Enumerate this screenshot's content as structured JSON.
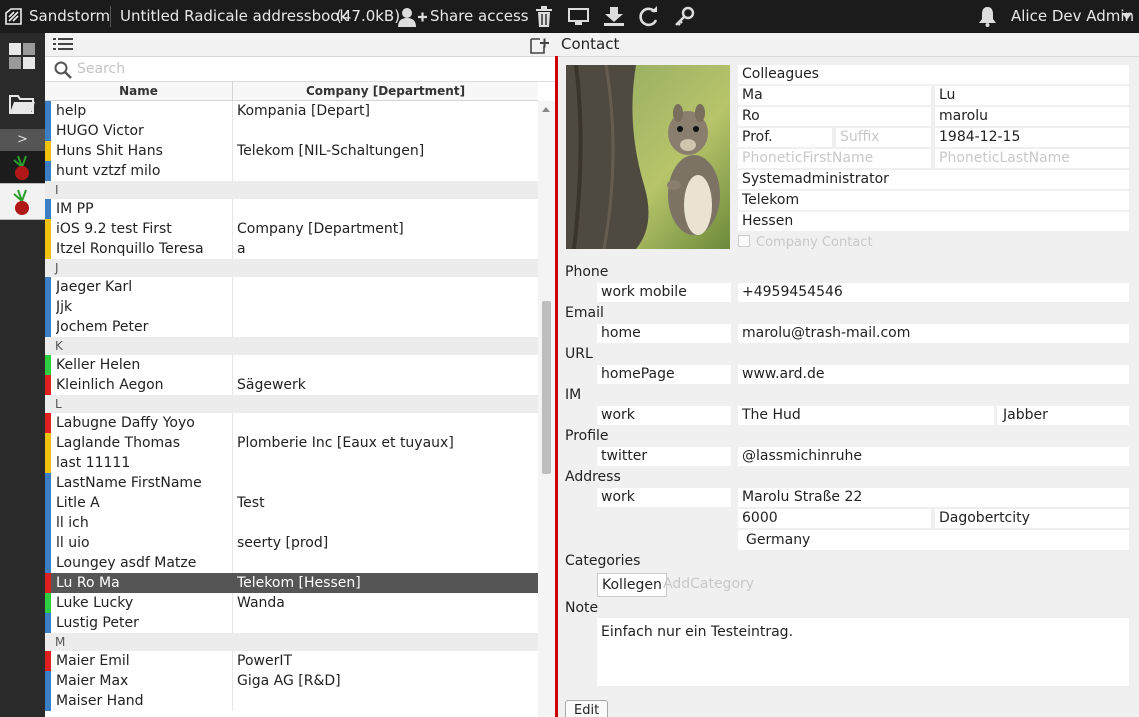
{
  "topbar": {
    "brand": "Sandstorm",
    "grain_title": "Untitled Radicale addressbook",
    "grain_size": "(47.0kB)",
    "share_access": "Share access",
    "user": "Alice Dev Admin",
    "icons": [
      "sandstorm-logo-icon",
      "add-user-icon",
      "trash-icon",
      "monitor-icon",
      "download-icon",
      "refresh-icon",
      "key-icon",
      "bell-icon",
      "chevron-down-icon"
    ]
  },
  "leftbar": {
    "collapse_label": ">",
    "icons": [
      "grid-icon",
      "folder-icon",
      "app-icon"
    ]
  },
  "list": {
    "search_placeholder": "Search",
    "columns": [
      "Name",
      "Company [Department]"
    ],
    "rows": [
      {
        "type": "contact",
        "name": "help",
        "company": "Kompania [Depart]",
        "color": "#3a7fc4"
      },
      {
        "type": "contact",
        "name": "HUGO Victor",
        "company": "",
        "color": "#3a7fc4"
      },
      {
        "type": "contact",
        "name": "Huns Shit Hans",
        "company": "Telekom [NIL-Schaltungen]",
        "color": "#f4c20d"
      },
      {
        "type": "contact",
        "name": "hunt vztzf milo",
        "company": "",
        "color": "#3a7fc4"
      },
      {
        "type": "letter",
        "name": "I"
      },
      {
        "type": "contact",
        "name": "IM PP",
        "company": "",
        "color": "#3a7fc4"
      },
      {
        "type": "contact",
        "name": "iOS 9.2 test First",
        "company": "Company [Department]",
        "color": "#f4c20d"
      },
      {
        "type": "contact",
        "name": "Itzel Ronquillo Teresa",
        "company": "a",
        "color": "#f4c20d"
      },
      {
        "type": "letter",
        "name": "J"
      },
      {
        "type": "contact",
        "name": "Jaeger Karl",
        "company": "",
        "color": "#3a7fc4"
      },
      {
        "type": "contact",
        "name": "Jjk",
        "company": "",
        "color": "#3a7fc4"
      },
      {
        "type": "contact",
        "name": "Jochem Peter",
        "company": "",
        "color": "#3a7fc4"
      },
      {
        "type": "letter",
        "name": "K"
      },
      {
        "type": "contact",
        "name": "Keller Helen",
        "company": "",
        "color": "#2ecc40"
      },
      {
        "type": "contact",
        "name": "Kleinlich Aegon",
        "company": "Sägewerk",
        "color": "#e02020"
      },
      {
        "type": "letter",
        "name": "L"
      },
      {
        "type": "contact",
        "name": "Labugne Daffy Yoyo",
        "company": "",
        "color": "#e02020"
      },
      {
        "type": "contact",
        "name": "Laglande Thomas",
        "company": "Plomberie Inc [Eaux et tuyaux]",
        "color": "#f4c20d"
      },
      {
        "type": "contact",
        "name": "last 11111",
        "company": "",
        "color": "#f4c20d"
      },
      {
        "type": "contact",
        "name": "LastName FirstName",
        "company": "",
        "color": "#3a7fc4"
      },
      {
        "type": "contact",
        "name": "Litle A",
        "company": "Test",
        "color": "#3a7fc4"
      },
      {
        "type": "contact",
        "name": "ll ich",
        "company": "",
        "color": "#3a7fc4"
      },
      {
        "type": "contact",
        "name": "ll uio",
        "company": "seerty [prod]",
        "color": "#3a7fc4"
      },
      {
        "type": "contact",
        "name": "Loungey asdf Matze",
        "company": "",
        "color": "#3a7fc4"
      },
      {
        "type": "contact",
        "name": "Lu Ro Ma",
        "company": "Telekom [Hessen]",
        "color": "#e02020",
        "selected": true
      },
      {
        "type": "contact",
        "name": "Luke Lucky",
        "company": "Wanda",
        "color": "#2ecc40"
      },
      {
        "type": "contact",
        "name": "Lustig Peter",
        "company": "",
        "color": "#3a7fc4"
      },
      {
        "type": "letter",
        "name": "M"
      },
      {
        "type": "contact",
        "name": "Maier Emil",
        "company": "PowerIT",
        "color": "#e02020"
      },
      {
        "type": "contact",
        "name": "Maier Max",
        "company": "Giga AG [R&D]",
        "color": "#3a7fc4"
      },
      {
        "type": "contact",
        "name": "Maiser Hand",
        "company": "",
        "color": "#3a7fc4"
      }
    ]
  },
  "detail": {
    "header": "Contact",
    "group": "Colleagues",
    "first_name": "Ma",
    "last_name": "Lu",
    "middle_name": "Ro",
    "nickname": "marolu",
    "prefix": "Prof.",
    "suffix_placeholder": "Suffix",
    "birthday": "1984-12-15",
    "phonetic_first_placeholder": "PhoneticFirstName",
    "phonetic_last_placeholder": "PhoneticLastName",
    "title": "Systemadministrator",
    "company": "Telekom",
    "department": "Hessen",
    "company_contact_label": "Company Contact",
    "sections": {
      "phone": {
        "label": "Phone",
        "type": "work mobile",
        "value": "+4959454546"
      },
      "email": {
        "label": "Email",
        "type": "home",
        "value": "marolu@trash-mail.com"
      },
      "url": {
        "label": "URL",
        "type": "homePage",
        "value": "www.ard.de"
      },
      "im": {
        "label": "IM",
        "type": "work",
        "value": "The Hud",
        "service": "Jabber"
      },
      "profile": {
        "label": "Profile",
        "type": "twitter",
        "value": "@lassmichinruhe"
      },
      "address": {
        "label": "Address",
        "type": "work",
        "street": "Marolu Straße 22",
        "zip": "6000",
        "city": "Dagobertcity",
        "country": "Germany"
      }
    },
    "categories_label": "Categories",
    "category": "Kollegen",
    "add_category_placeholder": "AddCategory",
    "note_label": "Note",
    "note": "Einfach nur ein Testeintrag.",
    "edit_label": "Edit"
  }
}
